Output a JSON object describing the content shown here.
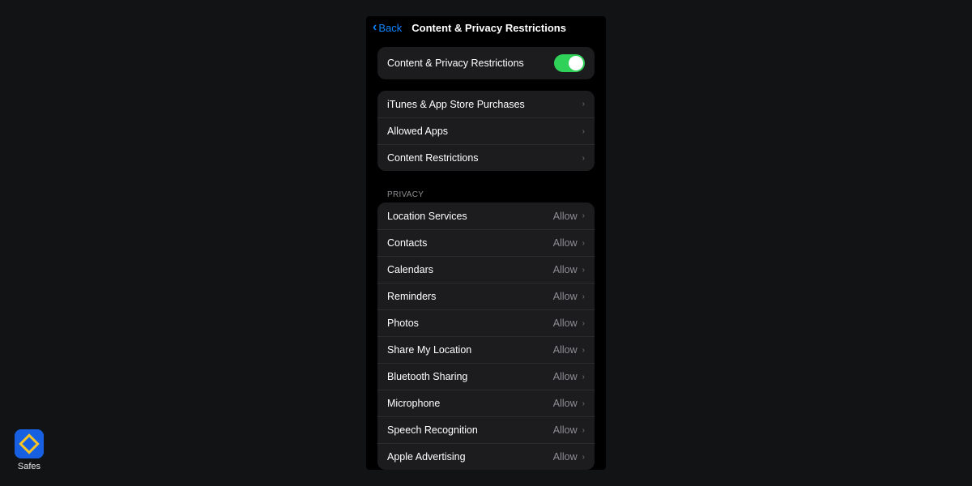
{
  "header": {
    "back_label": "Back",
    "title": "Content & Privacy Restrictions"
  },
  "toggle_section": {
    "label": "Content & Privacy Restrictions",
    "enabled": true
  },
  "nav_items": [
    {
      "label": "iTunes & App Store Purchases"
    },
    {
      "label": "Allowed Apps"
    },
    {
      "label": "Content Restrictions"
    }
  ],
  "privacy_header": "PRIVACY",
  "privacy_items": [
    {
      "label": "Location Services",
      "value": "Allow"
    },
    {
      "label": "Contacts",
      "value": "Allow"
    },
    {
      "label": "Calendars",
      "value": "Allow"
    },
    {
      "label": "Reminders",
      "value": "Allow"
    },
    {
      "label": "Photos",
      "value": "Allow"
    },
    {
      "label": "Share My Location",
      "value": "Allow"
    },
    {
      "label": "Bluetooth Sharing",
      "value": "Allow"
    },
    {
      "label": "Microphone",
      "value": "Allow"
    },
    {
      "label": "Speech Recognition",
      "value": "Allow"
    },
    {
      "label": "Apple Advertising",
      "value": "Allow"
    }
  ],
  "logo": {
    "text": "Safes"
  }
}
